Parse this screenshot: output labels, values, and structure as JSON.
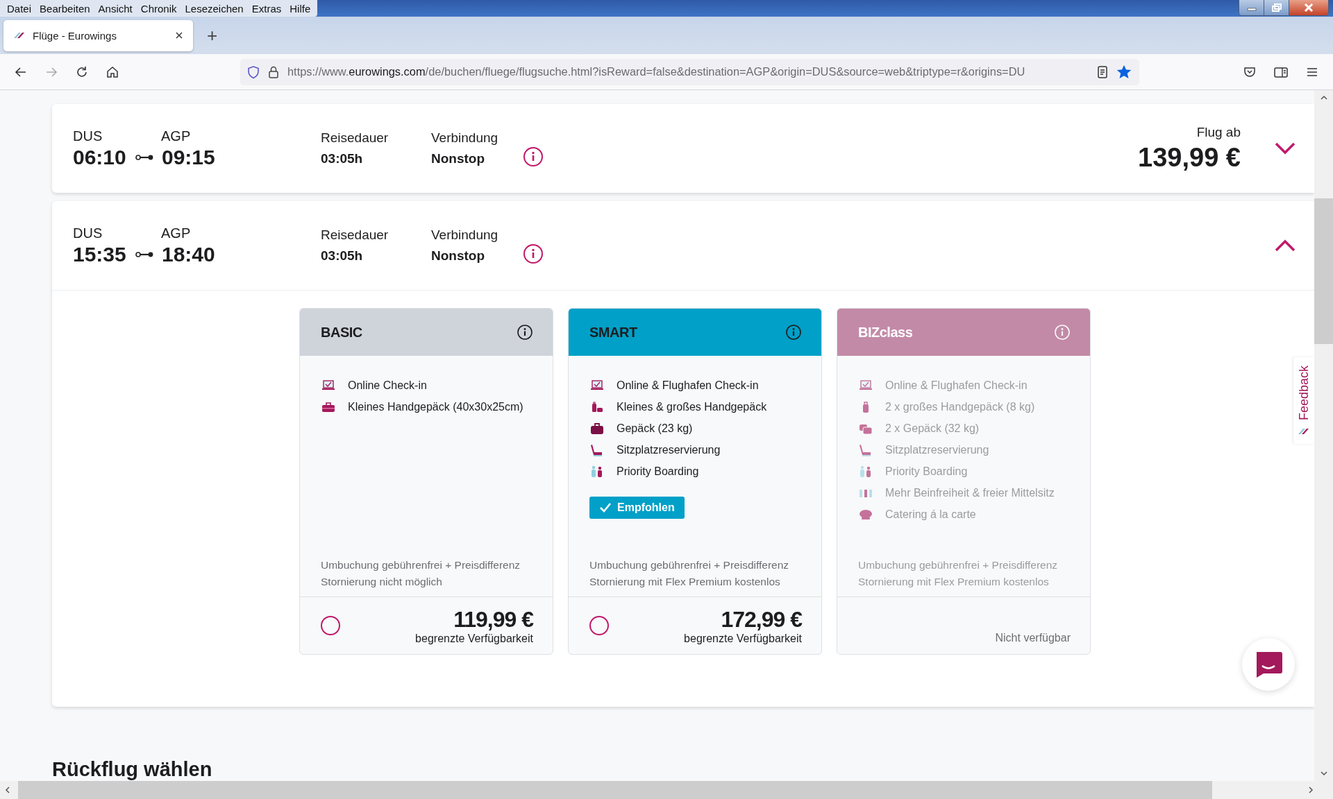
{
  "browser": {
    "menu": [
      "Datei",
      "Bearbeiten",
      "Ansicht",
      "Chronik",
      "Lesezeichen",
      "Extras",
      "Hilfe"
    ],
    "tab": {
      "title": "Flüge - Eurowings",
      "new_tab": "+"
    },
    "forward_enabled": false,
    "url": {
      "scheme": "https://www.",
      "host": "eurowings.com",
      "path": "/de/buchen/fluege/flugsuche.html?isReward=false&destination=AGP&origin=DUS&source=web&triptype=r&origins=DU"
    },
    "bookmarked": true
  },
  "flights": [
    {
      "from": "DUS",
      "to": "AGP",
      "departure": "06:10",
      "arrival": "09:15",
      "duration_label": "Reisedauer",
      "duration": "03:05h",
      "connection_label": "Verbindung",
      "connection": "Nonstop",
      "price_label": "Flug ab",
      "price": "139,99 €",
      "expanded": false
    },
    {
      "from": "DUS",
      "to": "AGP",
      "departure": "15:35",
      "arrival": "18:40",
      "duration_label": "Reisedauer",
      "duration": "03:05h",
      "connection_label": "Verbindung",
      "connection": "Nonstop",
      "expanded": true
    }
  ],
  "fares": [
    {
      "name": "BASIC",
      "kind": "basic",
      "available": true,
      "selected": false,
      "features": [
        {
          "kind": "laptop",
          "text": "Online Check-in"
        },
        {
          "kind": "small-bag",
          "text": "Kleines Handgepäck (40x30x25cm)"
        }
      ],
      "conditions": [
        "Umbuchung gebührenfrei + Preisdifferenz",
        "Stornierung nicht möglich"
      ],
      "price": "119,99 €",
      "availability": "begrenzte Verfügbarkeit"
    },
    {
      "name": "SMART",
      "kind": "smart",
      "available": true,
      "selected": false,
      "features": [
        {
          "kind": "laptop",
          "text": "Online & Flughafen Check-in"
        },
        {
          "kind": "bags",
          "text": "Kleines & großes Handgepäck"
        },
        {
          "kind": "suitcase",
          "text": "Gepäck (23 kg)"
        },
        {
          "kind": "seat",
          "text": "Sitzplatzreservierung"
        },
        {
          "kind": "people",
          "text": "Priority Boarding"
        }
      ],
      "badge": "Empfohlen",
      "conditions": [
        "Umbuchung gebührenfrei + Preisdifferenz",
        "Stornierung mit Flex Premium kostenlos"
      ],
      "price": "172,99 €",
      "availability": "begrenzte Verfügbarkeit"
    },
    {
      "name": "BIZclass",
      "kind": "biz",
      "available": false,
      "features": [
        {
          "kind": "laptop",
          "text": "Online & Flughafen Check-in"
        },
        {
          "kind": "trolley",
          "text": "2 x großes Handgepäck (8 kg)"
        },
        {
          "kind": "suitcases",
          "text": "2 x Gepäck (32 kg)"
        },
        {
          "kind": "seat",
          "text": "Sitzplatzreservierung"
        },
        {
          "kind": "people",
          "text": "Priority Boarding"
        },
        {
          "kind": "legroom",
          "text": "Mehr Beinfreiheit & freier Mittelsitz"
        },
        {
          "kind": "catering",
          "text": "Catering á la carte"
        }
      ],
      "conditions": [
        "Umbuchung gebührenfrei + Preisdifferenz",
        "Stornierung mit Flex Premium kostenlos"
      ],
      "unavailable_text": "Nicht verfügbar"
    }
  ],
  "feedback": "Feedback",
  "section_title": "Rückflug wählen"
}
